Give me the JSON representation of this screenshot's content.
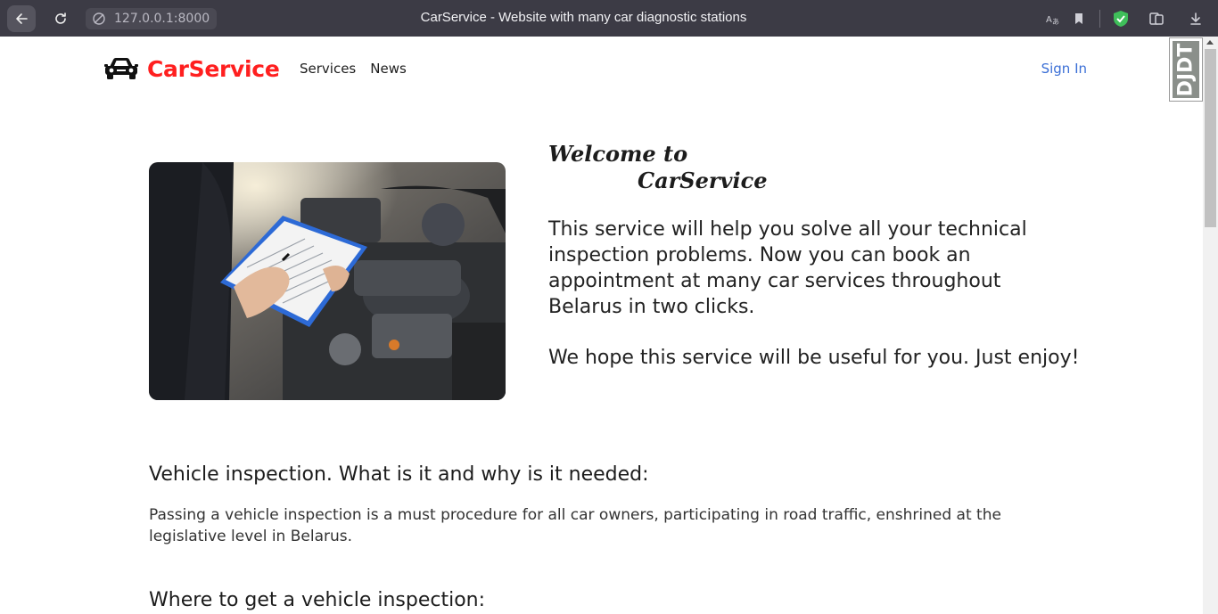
{
  "browser": {
    "url": "127.0.0.1:8000",
    "tab_title": "CarService - Website with many car diagnostic stations"
  },
  "nav": {
    "brand": "CarService",
    "links": [
      "Services",
      "News"
    ],
    "signin": "Sign In"
  },
  "extension_badge": "DJDT",
  "hero": {
    "welcome_line1": "Welcome to",
    "welcome_line2": "CarService",
    "intro": "This service will help you solve all your technical inspection problems. Now you can book an appointment at many car services throughout Belarus in two clicks.",
    "intro2": "We hope this service will be useful for you. Just enjoy!"
  },
  "sections": [
    {
      "heading": "Vehicle inspection. What is it and why is it needed:",
      "text": "Passing a vehicle inspection is a must procedure for all car owners, participating in road traffic, enshrined at the legislative level in Belarus."
    },
    {
      "heading": "Where to get a vehicle inspection:"
    }
  ],
  "colors": {
    "brand": "#ff1f1f",
    "link": "#3b6fd6",
    "chrome": "#3c3b45"
  }
}
